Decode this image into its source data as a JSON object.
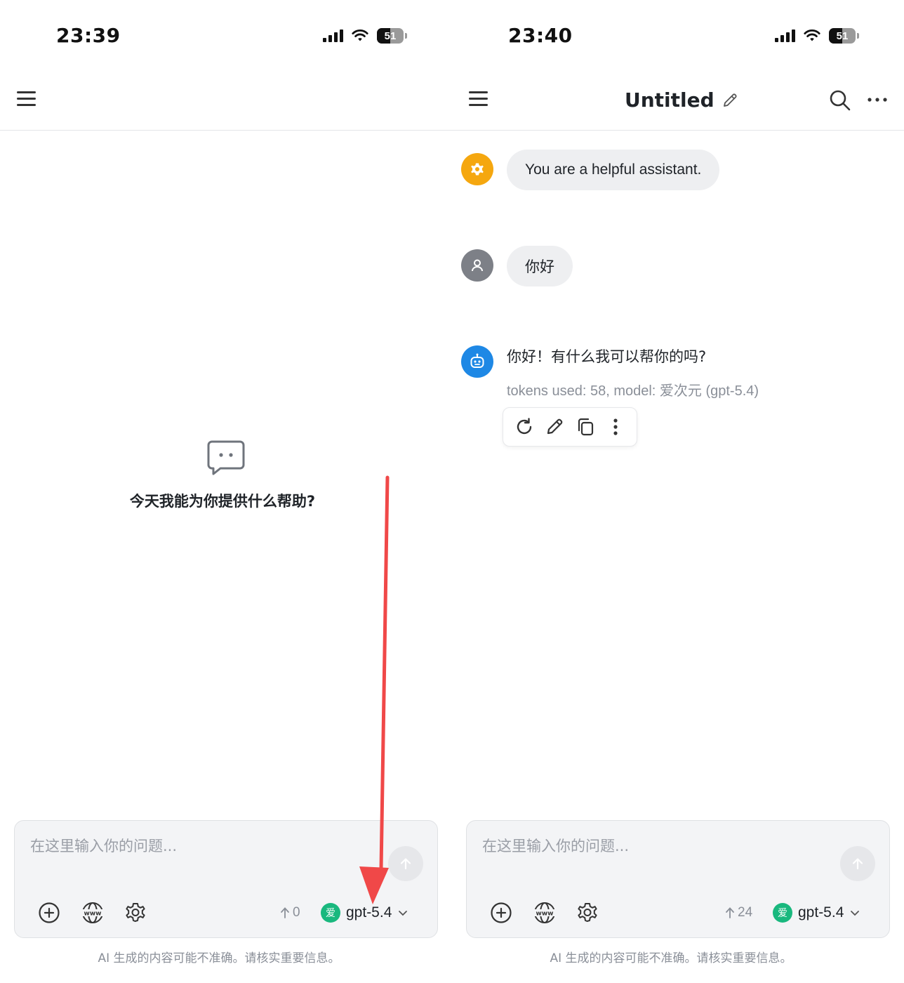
{
  "left_screen": {
    "status_bar": {
      "time": "23:39",
      "battery": "51",
      "battery_level": 0.51
    },
    "empty_state": {
      "text": "今天我能为你提供什么帮助?"
    },
    "composer": {
      "placeholder": "在这里输入你的问题...",
      "token_count": "0",
      "model_badge": "爱",
      "model": "gpt-5.4"
    },
    "disclaimer": "AI 生成的内容可能不准确。请核实重要信息。"
  },
  "right_screen": {
    "status_bar": {
      "time": "23:40",
      "battery": "51",
      "battery_level": 0.51
    },
    "header": {
      "title": "Untitled"
    },
    "messages": {
      "system": "You are a helpful assistant.",
      "user": "你好",
      "assistant": "你好！有什么我可以帮你的吗?",
      "meta": "tokens used: 58, model: 爱次元 (gpt-5.4)"
    },
    "composer": {
      "placeholder": "在这里输入你的问题...",
      "token_count": "24",
      "model_badge": "爱",
      "model": "gpt-5.4"
    },
    "disclaimer": "AI 生成的内容可能不准确。请核实重要信息。"
  },
  "icons": {
    "menu": "hamburger-icon",
    "edit": "pencil-icon",
    "search": "search-icon",
    "more": "more-horizontal-icon",
    "system_avatar": "gear-icon",
    "user_avatar": "person-icon",
    "assistant_avatar": "robot-icon",
    "regenerate": "refresh-icon",
    "copy": "copy-icon",
    "more_vertical": "more-vertical-icon",
    "attach": "plus-circle-icon",
    "web": "globe-www-icon",
    "settings": "gear-icon",
    "send": "arrow-up-icon",
    "dropdown": "chevron-down-icon",
    "empty_state": "chat-bubble-icon",
    "annotation": "red-arrow-icon"
  },
  "colors": {
    "system_avatar": "#f5a70f",
    "user_avatar": "#7d8087",
    "assistant_avatar": "#1e88e5",
    "model_badge": "#19b87e",
    "annotation_arrow": "#f04848"
  }
}
